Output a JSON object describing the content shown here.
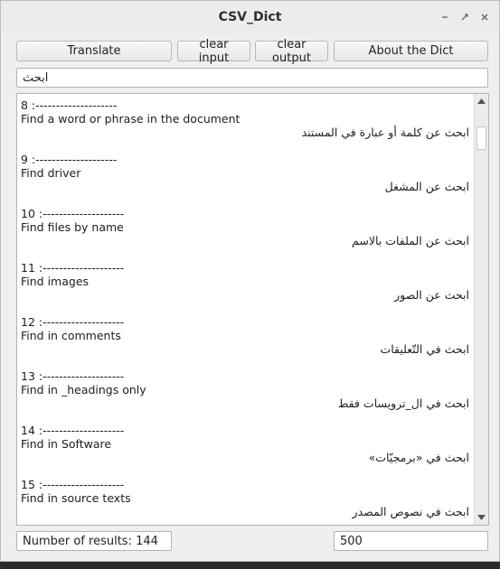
{
  "window": {
    "title": "CSV_Dict"
  },
  "toolbar": {
    "translate_label": "Translate",
    "clear_input_label": "clear input",
    "clear_output_label": "clear output",
    "about_label": "About the Dict"
  },
  "search": {
    "value": "ابحث"
  },
  "results": [
    {
      "sep": "8 :--------------------",
      "en": "Find a word or phrase in the document",
      "ar": "ابحث عن كلمة أو عبارة في المستند"
    },
    {
      "sep": "9 :--------------------",
      "en": "Find driver",
      "ar": "ابحث عن المشغل"
    },
    {
      "sep": "10 :--------------------",
      "en": "Find files by name",
      "ar": "ابحث عن الملفات بالاسم"
    },
    {
      "sep": "11 :--------------------",
      "en": "Find images",
      "ar": "ابحث عن الصور"
    },
    {
      "sep": "12 :--------------------",
      "en": "Find in comments",
      "ar": "ابحث في التّعليقات"
    },
    {
      "sep": "13 :--------------------",
      "en": "Find in _headings only",
      "ar": "ابحث في ال_ترويسات فقط"
    },
    {
      "sep": "14 :--------------------",
      "en": "Find in Software",
      "ar": "ابحث في «برمجيّات»"
    },
    {
      "sep": "15 :--------------------",
      "en": "Find in source texts",
      "ar": "ابحث في نصوص المصدر"
    }
  ],
  "status": {
    "results_text": "Number of results: 144",
    "limit_value": "500"
  },
  "icons": {
    "minimize": "minimize-icon",
    "restore": "restore-icon",
    "close": "close-icon",
    "scroll_up": "arrow-up-icon",
    "scroll_down": "arrow-down-icon"
  }
}
